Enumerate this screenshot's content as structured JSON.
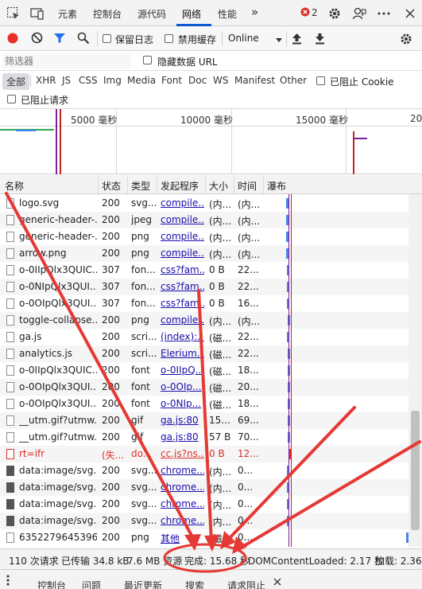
{
  "top_tabs": [
    {
      "label": "元素"
    },
    {
      "label": "控制台"
    },
    {
      "label": "源代码"
    },
    {
      "label": "网络"
    },
    {
      "label": "性能"
    }
  ],
  "more_tabs": "»",
  "error_count": "2",
  "toolbar": {
    "preserve_log": "保留日志",
    "disable_cache": "禁用缓存",
    "throttle": "Online"
  },
  "filter": {
    "placeholder": "筛选器",
    "hide_data_urls": "隐藏数据 URL"
  },
  "types": [
    {
      "label": "全部"
    },
    {
      "label": "XHR"
    },
    {
      "label": "JS"
    },
    {
      "label": "CSS"
    },
    {
      "label": "Img"
    },
    {
      "label": "Media"
    },
    {
      "label": "Font"
    },
    {
      "label": "Doc"
    },
    {
      "label": "WS"
    },
    {
      "label": "Manifest"
    },
    {
      "label": "Other"
    }
  ],
  "blocked_cookies": "已阻止 Cookie",
  "blocked_requests": "已阻止请求",
  "overview_ticks": [
    {
      "label": "5000 毫秒"
    },
    {
      "label": "10000 毫秒"
    },
    {
      "label": "15000 毫秒"
    },
    {
      "label": "20"
    }
  ],
  "columns": {
    "name": "名称",
    "status": "状态",
    "type": "类型",
    "initiator": "发起程序",
    "size": "大小",
    "time": "时间",
    "waterfall": "瀑布"
  },
  "rows": [
    {
      "name": "logo.svg",
      "status": "200",
      "type": "svg...",
      "initiator": "compile...",
      "size": "(内...",
      "time": "(内...",
      "error": false
    },
    {
      "name": "generic-header-...",
      "status": "200",
      "type": "jpeg",
      "initiator": "compile...",
      "size": "(内...",
      "time": "(内...",
      "error": false
    },
    {
      "name": "generic-header-...",
      "status": "200",
      "type": "png",
      "initiator": "compile...",
      "size": "(内...",
      "time": "(内...",
      "error": false
    },
    {
      "name": "arrow.png",
      "status": "200",
      "type": "png",
      "initiator": "compile...",
      "size": "(内...",
      "time": "(内...",
      "error": false
    },
    {
      "name": "o-0IIpQlx3QUIC...",
      "status": "307",
      "type": "fon...",
      "initiator": "css?fam...",
      "size": "0 B",
      "time": "22...",
      "error": false
    },
    {
      "name": "o-0NIpQlx3QUI...",
      "status": "307",
      "type": "fon...",
      "initiator": "css?fam...",
      "size": "0 B",
      "time": "22...",
      "error": false
    },
    {
      "name": "o-0OIpQlx3QUI...",
      "status": "307",
      "type": "fon...",
      "initiator": "css?fam...",
      "size": "0 B",
      "time": "16...",
      "error": false
    },
    {
      "name": "toggle-collapse...",
      "status": "200",
      "type": "png",
      "initiator": "compile...",
      "size": "(内...",
      "time": "(内...",
      "error": false
    },
    {
      "name": "ga.js",
      "status": "200",
      "type": "scri...",
      "initiator": "(index):...",
      "size": "(磁...",
      "time": "22...",
      "error": false
    },
    {
      "name": "analytics.js",
      "status": "200",
      "type": "scri...",
      "initiator": "Elerium...",
      "size": "(磁...",
      "time": "22...",
      "error": false
    },
    {
      "name": "o-0IIpQlx3QUIC...",
      "status": "200",
      "type": "font",
      "initiator": "o-0IIpQ...",
      "size": "(磁...",
      "time": "18...",
      "error": false
    },
    {
      "name": "o-0OIpQlx3QUI...",
      "status": "200",
      "type": "font",
      "initiator": "o-0OIp...",
      "size": "(磁...",
      "time": "20...",
      "error": false
    },
    {
      "name": "o-0OIpQlx3QUI...",
      "status": "200",
      "type": "font",
      "initiator": "o-0NIp...",
      "size": "(磁...",
      "time": "18...",
      "error": false
    },
    {
      "name": "__utm.gif?utmw...",
      "status": "200",
      "type": "gif",
      "initiator": "ga.js:80",
      "size": "15...",
      "time": "69...",
      "error": false
    },
    {
      "name": "__utm.gif?utmw...",
      "status": "200",
      "type": "gif",
      "initiator": "ga.js:80",
      "size": "57 B",
      "time": "70...",
      "error": false
    },
    {
      "name": "rt=ifr",
      "status": "(失...",
      "type": "do...",
      "initiator": "cc.js?ns...",
      "size": "0 B",
      "time": "12...",
      "error": true
    },
    {
      "name": "data:image/svg...",
      "status": "200",
      "type": "svg...",
      "initiator": "chrome...",
      "size": "(内...",
      "time": "0...",
      "error": false
    },
    {
      "name": "data:image/svg...",
      "status": "200",
      "type": "svg...",
      "initiator": "chrome...",
      "size": "(内...",
      "time": "0...",
      "error": false
    },
    {
      "name": "data:image/svg...",
      "status": "200",
      "type": "svg...",
      "initiator": "chrome...",
      "size": "(内...",
      "time": "0...",
      "error": false
    },
    {
      "name": "data:image/svg...",
      "status": "200",
      "type": "svg...",
      "initiator": "chrome...",
      "size": "(内...",
      "time": "0...",
      "error": false
    },
    {
      "name": "6352279645396...",
      "status": "200",
      "type": "png",
      "initiator": "其他",
      "size": "(磁...",
      "time": "0...",
      "error": false
    }
  ],
  "status_bar": {
    "requests": "110 次请求",
    "transferred": "已传输 34.8 kB",
    "resources": "7.6 MB 资源",
    "finish": "完成: 15.68 秒",
    "dcl": "DOMContentLoaded: 2.17 秒",
    "load": "加载: 2.36 秒"
  },
  "drawer_tabs": [
    {
      "label": "控制台"
    },
    {
      "label": "问题"
    },
    {
      "label": "最近更新"
    },
    {
      "label": "搜索"
    },
    {
      "label": "请求阻止"
    }
  ],
  "colors": {
    "accent": "#0b57d0",
    "annotation": "#e53935",
    "record": "#e8312a",
    "error_text": "#d93025"
  },
  "icons": [
    "inspect-icon",
    "device-icon",
    "error-icon",
    "gear-icon",
    "feedback-icon",
    "more-icon",
    "record-icon",
    "clear-icon",
    "filter-icon",
    "search-icon",
    "upload-icon",
    "download-icon"
  ]
}
